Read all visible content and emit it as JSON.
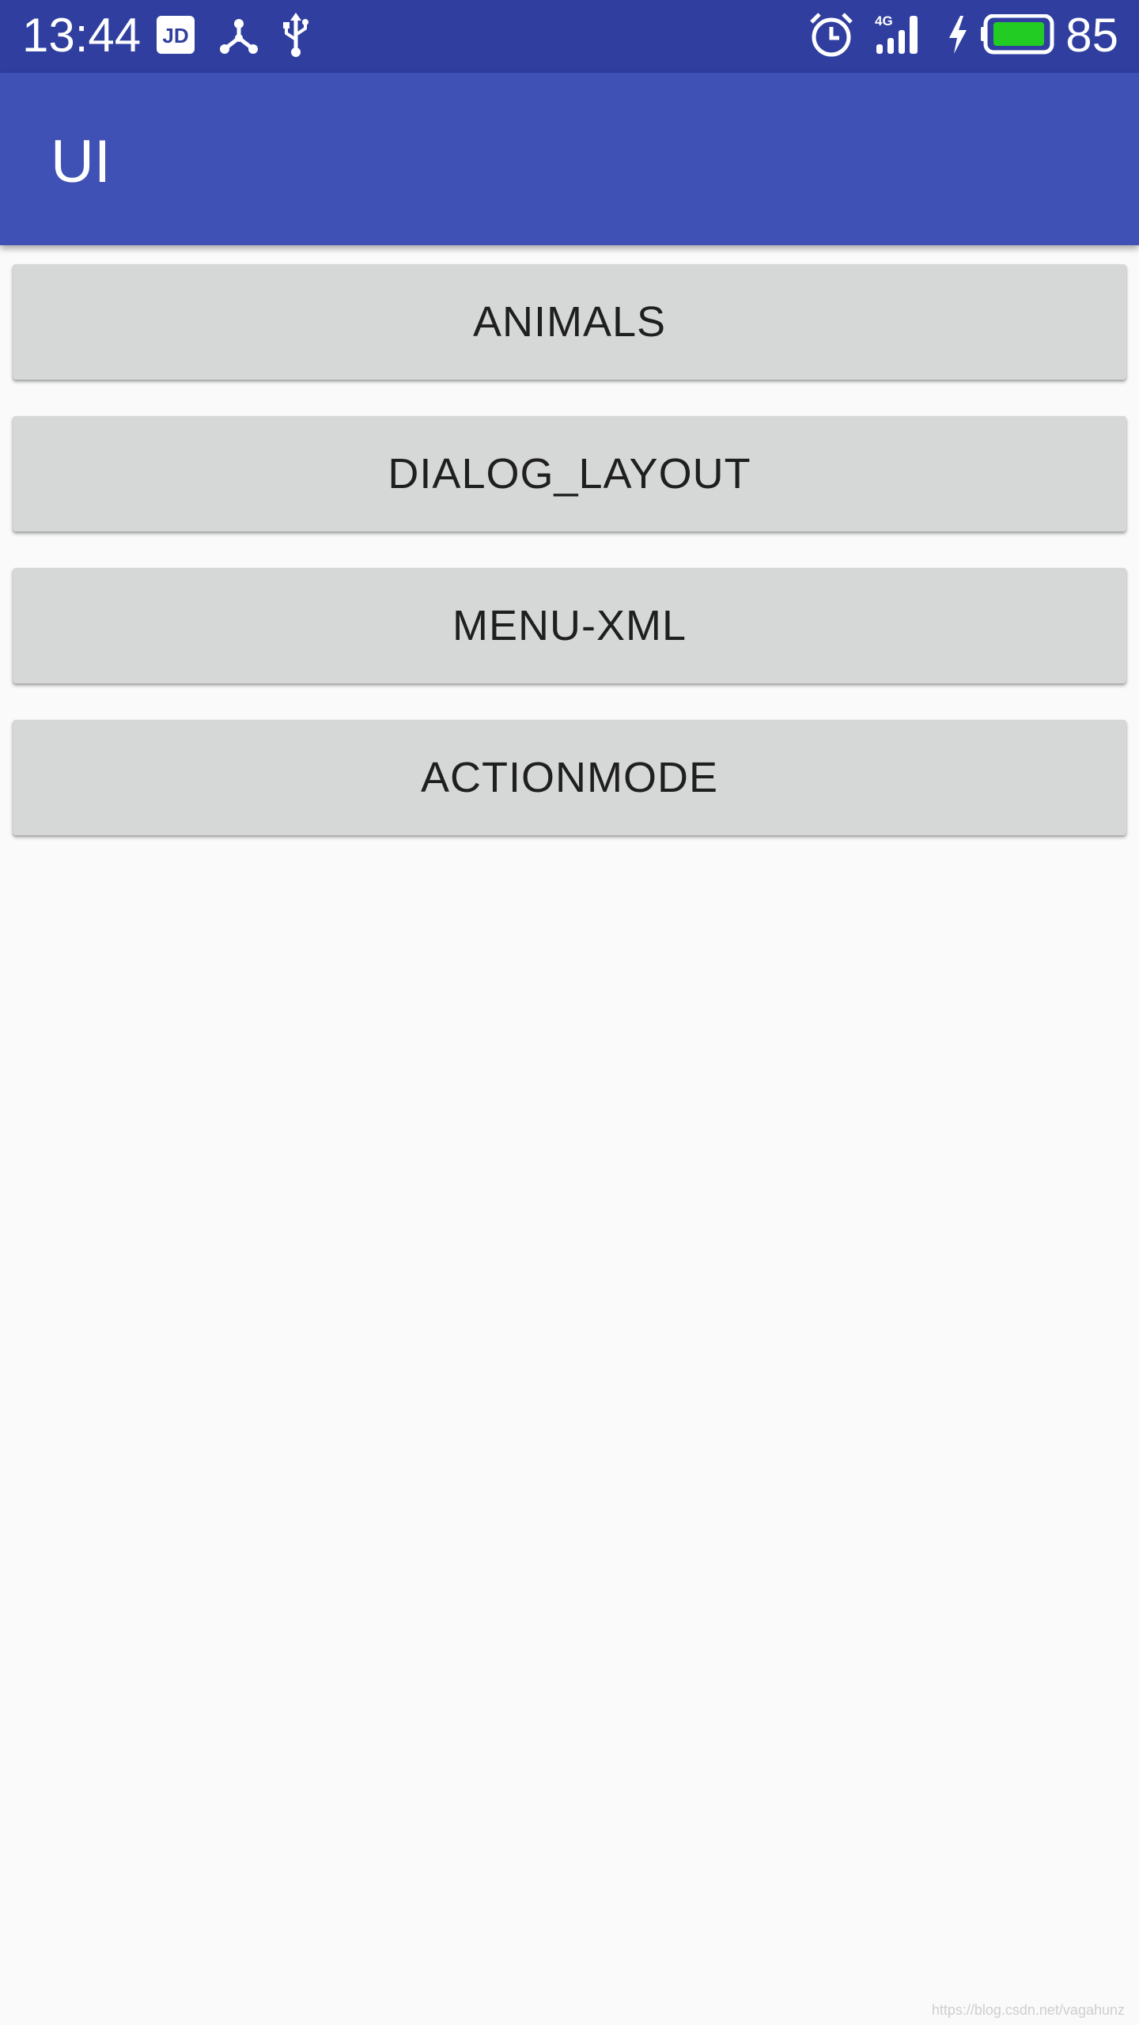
{
  "status_bar": {
    "time": "13:44",
    "battery_level": "85",
    "network": "4G",
    "icons": [
      "jd-app-icon",
      "share-hub-icon",
      "usb-icon",
      "alarm-icon",
      "signal-4g-icon",
      "charging-bolt-icon",
      "battery-icon"
    ],
    "colors": {
      "background": "#303f9f",
      "battery_fill": "#22cc22"
    }
  },
  "app_bar": {
    "title": "UI",
    "color": "#3f51b5"
  },
  "buttons": [
    {
      "label": "ANIMALS"
    },
    {
      "label": "DIALOG_LAYOUT"
    },
    {
      "label": "MENU-XML"
    },
    {
      "label": "ACTIONMODE"
    }
  ],
  "watermark": "https://blog.csdn.net/vagahunz"
}
